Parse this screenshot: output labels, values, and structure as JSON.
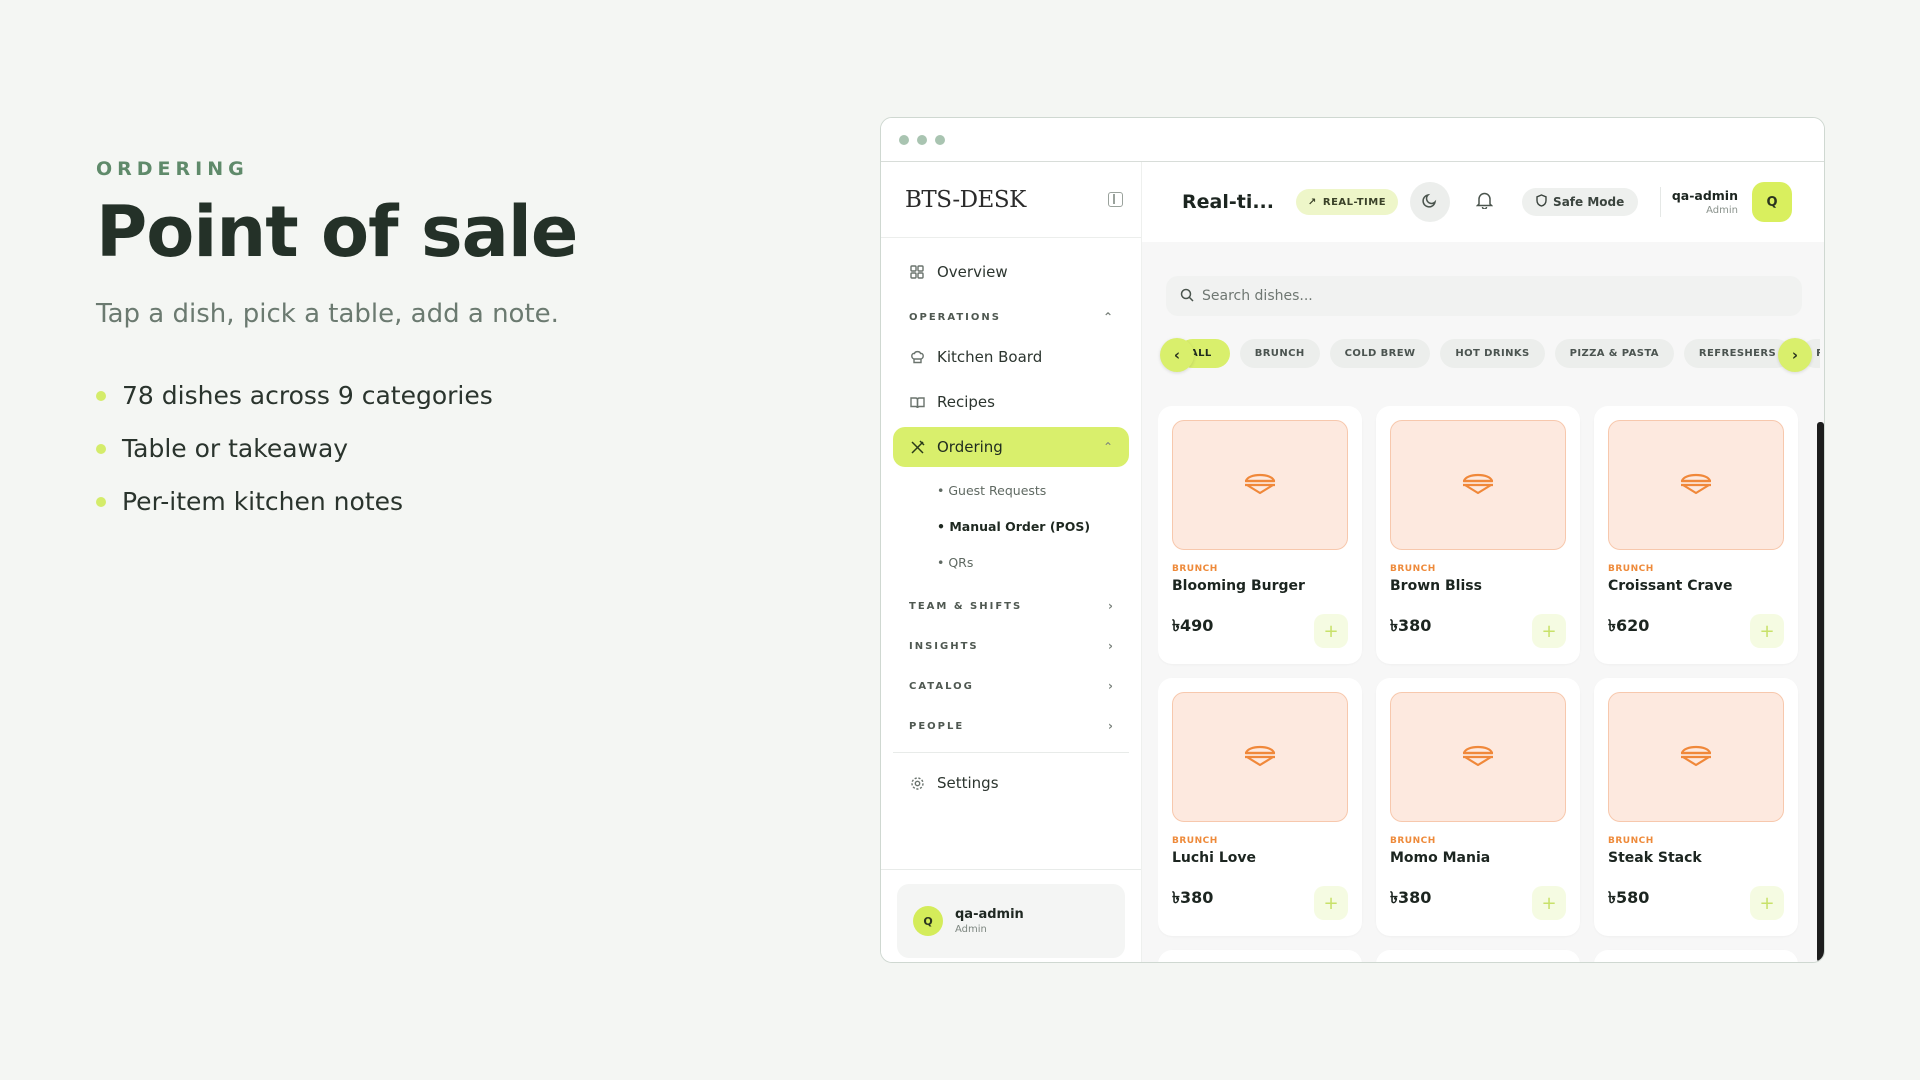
{
  "promo": {
    "eyebrow": "ORDERING",
    "headline": "Point of sale",
    "subline": "Tap a dish, pick a table, add a note.",
    "bullets": [
      "78 dishes across 9 categories",
      "Table or takeaway",
      "Per-item kitchen notes"
    ]
  },
  "app": {
    "brand": "BTS-DESK",
    "sidebar": {
      "overview": "Overview",
      "operations_section": "OPERATIONS",
      "kitchen_board": "Kitchen Board",
      "recipes": "Recipes",
      "ordering": "Ordering",
      "sub_items": [
        "• Guest Requests",
        "• Manual Order (POS)",
        "• QRs"
      ],
      "sections": [
        "TEAM & SHIFTS",
        "INSIGHTS",
        "CATALOG",
        "PEOPLE"
      ],
      "settings": "Settings",
      "user": {
        "initial": "Q",
        "name": "qa-admin",
        "role": "Admin"
      }
    },
    "topbar": {
      "title": "Real-ti...",
      "realtime_badge": "REAL-TIME",
      "safe_mode": "Safe Mode",
      "user": {
        "name": "qa-admin",
        "role": "Admin",
        "initial": "Q"
      }
    },
    "search": {
      "placeholder": "Search dishes..."
    },
    "categories": [
      "ALL",
      "BRUNCH",
      "COLD BREW",
      "HOT DRINKS",
      "PIZZA & PASTA",
      "REFRESHERS",
      "RI"
    ],
    "active_category": "ALL",
    "dishes": [
      {
        "category": "BRUNCH",
        "name": "Blooming Burger",
        "price": "৳490"
      },
      {
        "category": "BRUNCH",
        "name": "Brown Bliss",
        "price": "৳380"
      },
      {
        "category": "BRUNCH",
        "name": "Croissant Crave",
        "price": "৳620"
      },
      {
        "category": "BRUNCH",
        "name": "Luchi Love",
        "price": "৳380"
      },
      {
        "category": "BRUNCH",
        "name": "Momo Mania",
        "price": "৳380"
      },
      {
        "category": "BRUNCH",
        "name": "Steak Stack",
        "price": "৳580"
      }
    ],
    "icons": {
      "dish": "sandwich-icon",
      "add": "plus-icon"
    },
    "colors": {
      "accent": "#d9ef6c",
      "category_text": "#ee8a3a",
      "thumb_bg": "#fde9df"
    }
  }
}
